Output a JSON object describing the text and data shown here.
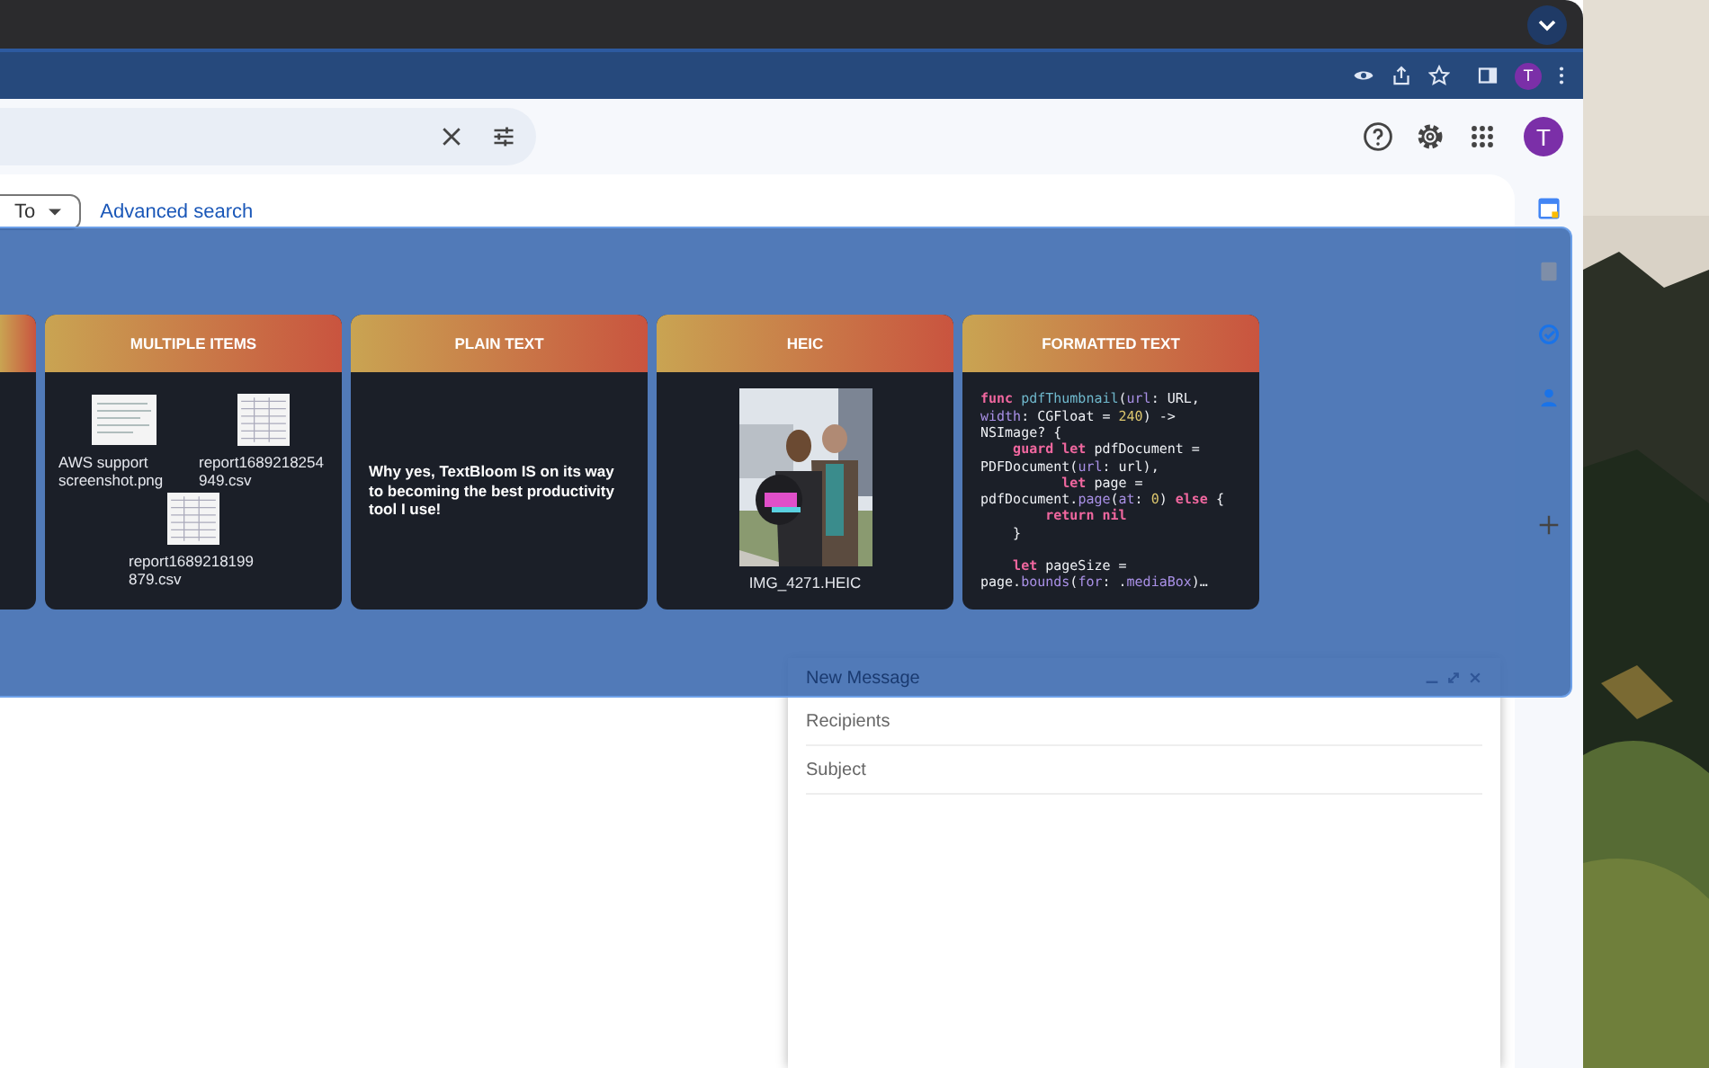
{
  "browser": {
    "profile_avatar": "T"
  },
  "gmail": {
    "account_avatar": "T",
    "filters": [
      {
        "label": "To"
      }
    ],
    "advanced_search": "Advanced search"
  },
  "clipboard_panel": {
    "cards": [
      {
        "kind": "clipped"
      },
      {
        "kind": "files",
        "title": "MULTIPLE ITEMS",
        "files": [
          {
            "name": "AWS support screenshot.png",
            "kind": "screenshot"
          },
          {
            "name": "report1689218254949.csv",
            "kind": "sheet"
          },
          {
            "name": "report1689218199879.csv",
            "kind": "sheet"
          }
        ]
      },
      {
        "kind": "text",
        "title": "PLAIN TEXT",
        "body": "Why yes, TextBloom IS on its way to becoming the best productivity tool I use!"
      },
      {
        "title": "HEIC",
        "caption": "IMG_4271.HEIC"
      },
      {
        "kind": "code",
        "title": "FORMATTED TEXT",
        "blocks": [
          [
            [
              {
                "kind": "keyword",
                "text": "func"
              },
              {
                "kind": "function",
                "text": " pdfThumbnail"
              },
              {
                "kind": "plain",
                "text": "("
              },
              {
                "kind": "argument",
                "text": "url"
              },
              {
                "kind": "plain",
                "text": ": URL,"
              }
            ],
            [
              {
                "kind": "argument",
                "text": "width"
              },
              {
                "kind": "plain",
                "text": ": CGFloat = "
              },
              {
                "kind": "number",
                "text": "240"
              },
              {
                "kind": "plain",
                "text": ") ->"
              }
            ],
            [
              {
                "kind": "plain",
                "text": "NSImage? {"
              }
            ],
            [
              {
                "kind": "keyword",
                "text": "    guard let"
              },
              {
                "kind": "plain",
                "text": " pdfDocument ="
              }
            ],
            [
              {
                "kind": "plain",
                "text": "PDFDocument("
              },
              {
                "kind": "argument",
                "text": "url"
              },
              {
                "kind": "plain",
                "text": ": url),"
              }
            ],
            [
              {
                "kind": "keyword",
                "text": "          let"
              },
              {
                "kind": "plain",
                "text": " page ="
              }
            ],
            [
              {
                "kind": "plain",
                "text": "pdfDocument."
              },
              {
                "kind": "argument",
                "text": "page"
              },
              {
                "kind": "plain",
                "text": "("
              },
              {
                "kind": "argument",
                "text": "at"
              },
              {
                "kind": "plain",
                "text": ": "
              },
              {
                "kind": "number",
                "text": "0"
              },
              {
                "kind": "plain",
                "text": ") "
              },
              {
                "kind": "keyword",
                "text": "else"
              },
              {
                "kind": "plain",
                "text": " {"
              }
            ],
            [
              {
                "kind": "keyword",
                "text": "        return nil"
              }
            ],
            [
              {
                "kind": "plain",
                "text": "    }"
              }
            ]
          ],
          [
            [
              {
                "kind": "keyword",
                "text": "    let"
              },
              {
                "kind": "plain",
                "text": " pageSize ="
              }
            ],
            [
              {
                "kind": "plain",
                "text": "page."
              },
              {
                "kind": "argument",
                "text": "bounds"
              },
              {
                "kind": "plain",
                "text": "("
              },
              {
                "kind": "argument",
                "text": "for"
              },
              {
                "kind": "plain",
                "text": ": ."
              },
              {
                "kind": "argument",
                "text": "mediaBox"
              },
              {
                "kind": "plain",
                "text": ")…"
              }
            ]
          ]
        ]
      }
    ]
  },
  "compose": {
    "title": "New Message",
    "fields": [
      {
        "placeholder": "Recipients"
      },
      {
        "placeholder": "Subject"
      }
    ]
  }
}
